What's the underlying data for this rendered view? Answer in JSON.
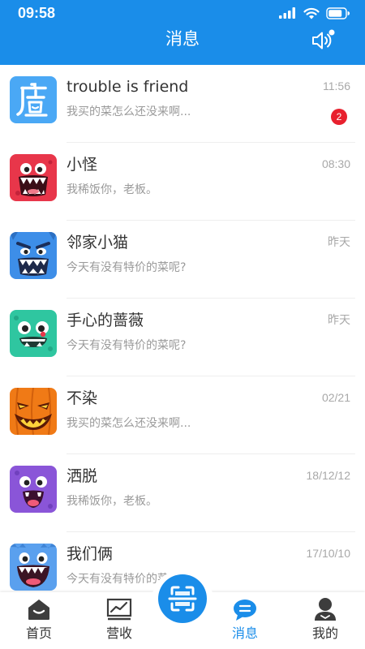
{
  "status_bar": {
    "time": "09:58"
  },
  "header": {
    "title": "消息"
  },
  "conversations": [
    {
      "name": "trouble is friend",
      "preview": "我买的菜怎么还没来啊...",
      "time": "11:56",
      "unread": "2",
      "avatar_icon": "shop-icon",
      "avatar_color": "#4aa8f5"
    },
    {
      "name": "小怪",
      "preview": "我稀饭你，老板。",
      "time": "08:30",
      "avatar_icon": "red-monster-avatar",
      "avatar_color": "#e8364a"
    },
    {
      "name": "邻家小猫",
      "preview": "今天有没有特价的菜呢?",
      "time": "昨天",
      "avatar_icon": "blue-monster-avatar",
      "avatar_color": "#3d8ee8"
    },
    {
      "name": "手心的蔷薇",
      "preview": "今天有没有特价的菜呢?",
      "time": "昨天",
      "avatar_icon": "green-monster-avatar",
      "avatar_color": "#2fc6a0"
    },
    {
      "name": "不染",
      "preview": "我买的菜怎么还没来啊...",
      "time": "02/21",
      "avatar_icon": "pumpkin-avatar",
      "avatar_color": "#f07a16"
    },
    {
      "name": "洒脱",
      "preview": "我稀饭你，老板。",
      "time": "18/12/12",
      "avatar_icon": "purple-monster-avatar",
      "avatar_color": "#8a55d8"
    },
    {
      "name": "我们俩",
      "preview": "今天有没有特价的菜呢?",
      "time": "17/10/10",
      "avatar_icon": "blue-furry-avatar",
      "avatar_color": "#5aa0ee"
    }
  ],
  "tabbar": {
    "home": "首页",
    "revenue": "营收",
    "messages": "消息",
    "mine": "我的"
  },
  "colors": {
    "brand": "#1a8de9",
    "badge": "#e8202e"
  }
}
